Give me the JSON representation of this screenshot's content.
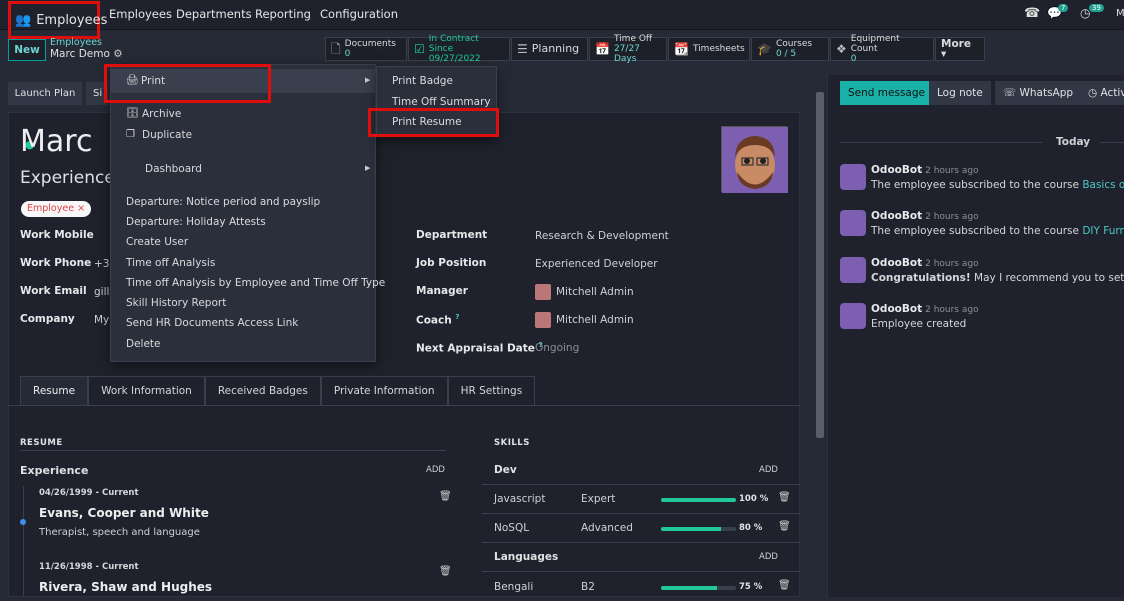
{
  "topbar": {
    "app_name": "Employees",
    "menus": [
      "Employees",
      "Departments",
      "Reporting",
      "Configuration"
    ],
    "activity_count": "7",
    "clock_count": "39",
    "user_initial": "M"
  },
  "control": {
    "new_label": "New",
    "breadcrumb_parent": "Employees",
    "breadcrumb_current": "Marc Demo",
    "smart_buttons": [
      {
        "label": "Documents",
        "value": "0",
        "icon": "file-icon"
      },
      {
        "label": "In Contract Since",
        "value": "09/27/2022",
        "icon": "check-square-icon"
      },
      {
        "label": "Planning",
        "value": "",
        "icon": "tasks-icon"
      },
      {
        "label": "Time Off",
        "value": "27/27 Days",
        "icon": "calendar-icon"
      },
      {
        "label": "Timesheets",
        "value": "",
        "icon": "calendar-grid-icon"
      },
      {
        "label": "Courses",
        "value": "0 / 5",
        "icon": "graduation-cap-icon"
      },
      {
        "label": "Equipment Count",
        "value": "0",
        "icon": "cubes-icon"
      }
    ],
    "more_label": "More ▾",
    "launch_plan": "Launch Plan",
    "next_btn": "Si"
  },
  "employee": {
    "name": "Marc",
    "job_title": "Experienced",
    "tag": "Employee ×",
    "left_fields": [
      {
        "label": "Work Mobile",
        "value": ""
      },
      {
        "label": "Work Phone",
        "value": "+32"
      },
      {
        "label": "Work Email",
        "value": "gille"
      },
      {
        "label": "Company",
        "value": "My"
      }
    ],
    "right_fields": [
      {
        "label": "Department",
        "value": "Research & Development"
      },
      {
        "label": "Job Position",
        "value": "Experienced Developer"
      },
      {
        "label": "Manager",
        "value": "Mitchell Admin"
      },
      {
        "label": "Coach",
        "sup": "?",
        "value": "Mitchell Admin"
      },
      {
        "label": "Next Appraisal Date",
        "sup": "?",
        "value": "Ongoing"
      }
    ]
  },
  "tabs": [
    "Resume",
    "Work Information",
    "Received Badges",
    "Private Information",
    "HR Settings"
  ],
  "resume": {
    "section": "RESUME",
    "group": "Experience",
    "add": "ADD",
    "items": [
      {
        "date": "04/26/1999 - Current",
        "title": "Evans, Cooper and White",
        "desc": "Therapist, speech and language"
      },
      {
        "date": "11/26/1998 - Current",
        "title": "Rivera, Shaw and Hughes",
        "desc": ""
      }
    ]
  },
  "skills": {
    "section": "SKILLS",
    "add": "ADD",
    "groups": [
      {
        "name": "Dev",
        "rows": [
          {
            "skill": "Javascript",
            "level": "Expert",
            "pct": 100,
            "pct_label": "100 %"
          },
          {
            "skill": "NoSQL",
            "level": "Advanced",
            "pct": 80,
            "pct_label": "80 %"
          }
        ]
      },
      {
        "name": "Languages",
        "rows": [
          {
            "skill": "Bengali",
            "level": "B2",
            "pct": 75,
            "pct_label": "75 %"
          }
        ]
      }
    ]
  },
  "action_menu": {
    "print": "Print",
    "archive": "Archive",
    "duplicate": "Duplicate",
    "dashboard": "Dashboard",
    "items": [
      "Departure: Notice period and payslip",
      "Departure: Holiday Attests",
      "Create User",
      "Time off Analysis",
      "Time off Analysis by Employee and Time Off Type",
      "Skill History Report",
      "Send HR Documents Access Link",
      "Delete"
    ]
  },
  "print_submenu": [
    "Print Badge",
    "Time Off Summary",
    "Print Resume"
  ],
  "chatter": {
    "send_message": "Send message",
    "log_note": "Log note",
    "whatsapp": "WhatsApp",
    "activities": "Activ",
    "today": "Today",
    "messages": [
      {
        "author": "OdooBot",
        "time": "- 2 hours ago",
        "text": "The employee subscribed to the course ",
        "link": "Basics of Furn"
      },
      {
        "author": "OdooBot",
        "time": "- 2 hours ago",
        "text": "The employee subscribed to the course ",
        "link": "DIY Furniture"
      },
      {
        "author": "OdooBot",
        "time": "- 2 hours ago",
        "bold": "Congratulations!",
        "text": " May I recommend you to setup an ",
        "link": "o"
      },
      {
        "author": "OdooBot",
        "time": "- 2 hours ago",
        "text": "Employee created",
        "link": ""
      }
    ]
  }
}
